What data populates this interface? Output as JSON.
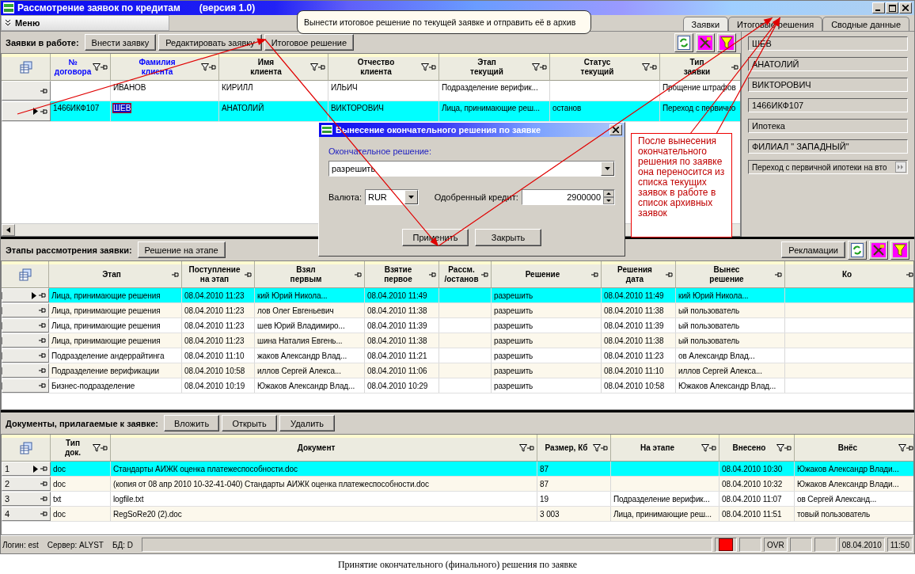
{
  "window": {
    "title": "Рассмотрение заявок по кредитам",
    "version": "(версия 1.0)"
  },
  "menu": {
    "label": "Меню"
  },
  "tabs": [
    {
      "label": "Заявки",
      "selected": true
    },
    {
      "label": "Итоговые решения",
      "selected": false
    },
    {
      "label": "Сводные данные",
      "selected": false
    }
  ],
  "requests": {
    "label": "Заявки в работе:",
    "buttons": [
      "Внести заявку",
      "Редактировать заявку",
      "Итоговое решение"
    ],
    "columns": [
      {
        "label": "№\nдоговора",
        "filter": true,
        "active": true
      },
      {
        "label": "Фамилия\nклиента",
        "filter": true,
        "active": true
      },
      {
        "label": "Имя\nклиента",
        "filter": true,
        "active": false
      },
      {
        "label": "Отчество\nклиента",
        "filter": true,
        "active": false
      },
      {
        "label": "Этап\nтекущий",
        "filter": true,
        "active": false
      },
      {
        "label": "Статус\nтекущий",
        "filter": true,
        "active": false
      },
      {
        "label": "Тип\nзаявки",
        "filter": false,
        "active": false
      }
    ],
    "rows": [
      {
        "selected": false,
        "current": false,
        "cells": [
          null,
          "ИВАНОВ",
          "КИРИЛЛ",
          "ИЛЬИЧ",
          "Подразделение верифик...",
          null,
          "Прощение штрафов"
        ]
      },
      {
        "selected": true,
        "current": true,
        "cells": [
          "1466ИКФ107",
          {
            "text": "ШЕВ",
            "focused": true
          },
          "АНАТОЛИЙ",
          "ВИКТОРОВИЧ",
          "Лица, принимающие реш...",
          "останов",
          "Переход с первично"
        ]
      }
    ]
  },
  "details": [
    {
      "kind": "text",
      "value": "ШЕВ"
    },
    {
      "kind": "text",
      "value": "АНАТОЛИЙ"
    },
    {
      "kind": "text",
      "value": "ВИКТОРОВИЧ"
    },
    {
      "kind": "text",
      "value": "1466ИКФ107"
    },
    {
      "kind": "text",
      "value": "Ипотека"
    },
    {
      "kind": "text",
      "value": "ФИЛИАЛ \" ЗАПАДНЫЙ\""
    },
    {
      "kind": "expand",
      "value": "Переход с первичной ипотеки на вто"
    }
  ],
  "stages": {
    "label": "Этапы рассмотрения заявки:",
    "buttons": [
      "Решение на этапе"
    ],
    "extra_button": "Рекламации",
    "columns": [
      {
        "label": "Этап",
        "filter": false,
        "active": false
      },
      {
        "label": "Поступление\nна этап",
        "filter": false,
        "active": false
      },
      {
        "label": "Взял\nпервым",
        "filter": false,
        "active": false
      },
      {
        "label": "Взятие\nпервое",
        "filter": false,
        "active": false
      },
      {
        "label": "Рассм.\n/останов",
        "filter": false,
        "active": false
      },
      {
        "label": "Решение",
        "filter": false,
        "active": false
      },
      {
        "label": "Решения\nдата",
        "filter": false,
        "active": false
      },
      {
        "label": "Вынес\nрешение",
        "filter": false,
        "active": false
      },
      {
        "label": "Ко",
        "filter": false,
        "active": false
      }
    ],
    "rows": [
      {
        "selected": true,
        "current": true,
        "cells": [
          "Лица, принимающие решения",
          "08.04.2010 11:23",
          "кий Юрий Никола...",
          "08.04.2010 11:49",
          null,
          "разрешить",
          "08.04.2010 11:49",
          "кий Юрий Никола...",
          null
        ]
      },
      {
        "selected": false,
        "current": false,
        "cells": [
          "Лица, принимающие решения",
          "08.04.2010 11:23",
          "лов Олег Евгеньевич",
          "08.04.2010 11:38",
          null,
          "разрешить",
          "08.04.2010 11:38",
          "ый пользователь",
          null
        ]
      },
      {
        "selected": false,
        "current": false,
        "cells": [
          "Лица, принимающие решения",
          "08.04.2010 11:23",
          "шев Юрий Владимиро...",
          "08.04.2010 11:39",
          null,
          "разрешить",
          "08.04.2010 11:39",
          "ый пользователь",
          null
        ]
      },
      {
        "selected": false,
        "current": false,
        "cells": [
          "Лица, принимающие решения",
          "08.04.2010 11:23",
          "шина Наталия Евгень...",
          "08.04.2010 11:38",
          null,
          "разрешить",
          "08.04.2010 11:38",
          "ый пользователь",
          null
        ]
      },
      {
        "selected": false,
        "current": false,
        "cells": [
          "Подразделение андеррайтинга",
          "08.04.2010 11:10",
          "жаков Александр Влад...",
          "08.04.2010 11:21",
          null,
          "разрешить",
          "08.04.2010 11:23",
          "ов Александр Влад...",
          null
        ]
      },
      {
        "selected": false,
        "current": false,
        "cells": [
          "Подразделение верификации",
          "08.04.2010 10:58",
          "иллов Сергей Алекса...",
          "08.04.2010 11:06",
          null,
          "разрешить",
          "08.04.2010 11:10",
          "иллов Сергей Алекса...",
          null
        ]
      },
      {
        "selected": false,
        "current": false,
        "cells": [
          "Бизнес-подразделение",
          "08.04.2010 10:19",
          "Южаков Александр Влад...",
          "08.04.2010 10:29",
          null,
          "разрешить",
          "08.04.2010 10:58",
          "Южаков Александр Влад...",
          null
        ]
      }
    ]
  },
  "documents": {
    "label": "Документы, прилагаемые к заявке:",
    "buttons": [
      "Вложить",
      "Открыть",
      "Удалить"
    ],
    "columns": [
      {
        "label": "Тип\nдок.",
        "filter": true,
        "active": false
      },
      {
        "label": "Документ",
        "filter": true,
        "active": false
      },
      {
        "label": "Размер, Кб",
        "filter": true,
        "active": false
      },
      {
        "label": "На этапе",
        "filter": true,
        "active": false
      },
      {
        "label": "Внесено",
        "filter": true,
        "active": false
      },
      {
        "label": "Внёс",
        "filter": true,
        "active": false
      }
    ],
    "rows": [
      {
        "number": "1",
        "selected": true,
        "current": true,
        "cells": [
          "doc",
          "Стандарты АИЖК оценка платежеспособности.doc",
          "87",
          null,
          "08.04.2010 10:30",
          "Южаков Александр Влади..."
        ]
      },
      {
        "number": "2",
        "selected": false,
        "current": false,
        "cells": [
          "doc",
          "(копия от 08 апр 2010 10-32-41-040) Стандарты АИЖК оценка платежеспособности.doc",
          "87",
          null,
          "08.04.2010 10:32",
          "Южаков Александр Влади..."
        ]
      },
      {
        "number": "3",
        "selected": false,
        "current": false,
        "cells": [
          "txt",
          "logfile.txt",
          "19",
          "Подразделение верифик...",
          "08.04.2010 11:07",
          "ов Сергей Александ..."
        ]
      },
      {
        "number": "4",
        "selected": false,
        "current": false,
        "cells": [
          "doc",
          "RegSoRe20 (2).doc",
          "3 003",
          "Лица, принимающие реш...",
          "08.04.2010 11:51",
          "товый пользователь"
        ]
      }
    ]
  },
  "status_bar": {
    "texts": [
      "Логин: est",
      "Сервер: ALYST",
      "БД: D"
    ],
    "panels": [
      {
        "kind": "spacer"
      },
      {
        "kind": "lamp",
        "on": true
      },
      {
        "kind": "empty"
      },
      {
        "kind": "text",
        "text": "OVR"
      },
      {
        "kind": "empty"
      },
      {
        "kind": "empty"
      },
      {
        "kind": "text",
        "text": "08.04.2010"
      },
      {
        "kind": "text",
        "text": "11:50"
      }
    ]
  },
  "tooltip": "Вынести итоговое решение по текущей заявке и отправить её в архив",
  "dialog": {
    "title": "Вынесение окончательного решения по заявке",
    "decision_label": "Окончательное решение:",
    "decision": "разрешить",
    "currency_label": "Валюта:",
    "currency": "RUR",
    "credit_label": "Одобренный кредит:",
    "credit": "2900000",
    "buttons": [
      "Применить",
      "Закрыть"
    ]
  },
  "note": "После вынесения окончательного решения по заявке она переносится из списка текущих заявок в работе в список архивных заявок",
  "caption": "Принятие окончательного (финального) решения по заявке"
}
